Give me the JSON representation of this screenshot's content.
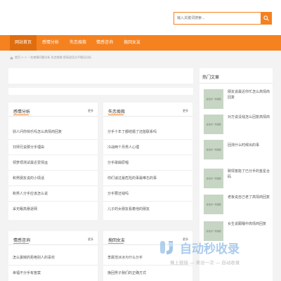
{
  "search": {
    "placeholder": "输入关键词搜索..."
  },
  "nav": [
    "网站首页",
    "感情分析",
    "失恋挽救",
    "情感咨询",
    "挽回女友"
  ],
  "breadcrumb": "首页 > > 一些感情问题分析 失恋挽救 提高说话水平情况分析",
  "boxes": [
    {
      "title": "感情分析",
      "more": "更多",
      "items": [
        "别人问你快乐吗怎么高情商回复",
        "刘师兄说那分手理由",
        "领梦烦测试最近爱情运",
        "和男朋友说的小情话",
        "和男人分手应该怎么说",
        "采无眠高悬逐网"
      ]
    },
    {
      "title": "失恋挽救",
      "more": "更多",
      "items": [
        "分手十年了都结婚了还能联系吗",
        "冷战两个月男人心理",
        "分手歌曲原唱",
        "你们谈过最危险的事最难忘的事",
        "分手要还钱吗",
        "儿子的女朋友看着他的朋友"
      ]
    },
    {
      "title": "情感咨询",
      "more": "更多",
      "items": [
        "怎么委婉的拒绝别人的喜欢",
        "幸福不分手有答案"
      ]
    },
    {
      "title": "挽回女友",
      "more": "更多",
      "items": [
        "李晨范冰冰为什么分手",
        "挽回男子我们的正确方式"
      ]
    }
  ],
  "sidebar": {
    "title": "热门文章",
    "thumb_label": "适当加一张插图",
    "items": [
      "朋友说最近你忙怎么高情商回复",
      "对方说没钱怎么回复高情商",
      "回测什么时候出的事",
      "致情答能了已分手的金星合码",
      "老板说自己老了高情商回复",
      "女生说跟睡中高情商回复"
    ]
  },
  "watermark": {
    "title": "自动秒收录",
    "sub": "做上链接 — 来访一次 — 自动收录"
  },
  "colors": {
    "accent": "#f5811f",
    "nav_active": "#e06d0e"
  }
}
